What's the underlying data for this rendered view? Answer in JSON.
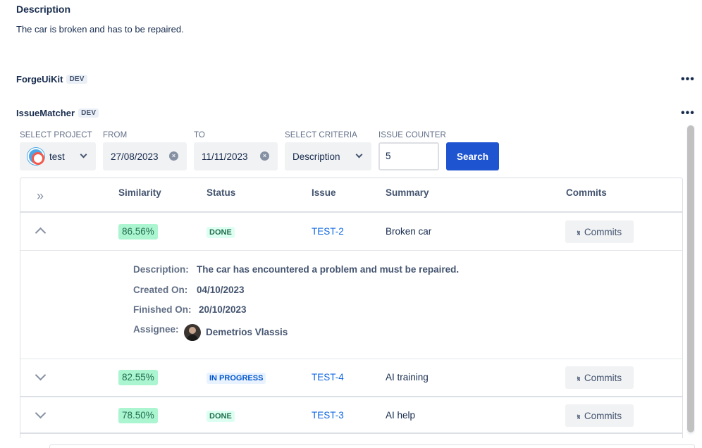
{
  "description": {
    "title": "Description",
    "text": "The car is broken and has to be repaired."
  },
  "apps": [
    {
      "name": "ForgeUiKit",
      "env": "DEV",
      "more": "•••"
    },
    {
      "name": "IssueMatcher",
      "env": "DEV",
      "more": "•••"
    }
  ],
  "filters": {
    "project": {
      "label": "SELECT PROJECT",
      "value": "test"
    },
    "from": {
      "label": "FROM",
      "value": "27/08/2023"
    },
    "to": {
      "label": "TO",
      "value": "11/11/2023"
    },
    "criteria": {
      "label": "SELECT CRITERIA",
      "value": "Description"
    },
    "counter": {
      "label": "ISSUE COUNTER",
      "value": "5"
    },
    "search_label": "Search"
  },
  "table": {
    "headers": [
      "Similarity",
      "Status",
      "Issue",
      "Summary",
      "Commits"
    ],
    "expand_all_icon": "»",
    "rows": [
      {
        "similarity": "86.56%",
        "status": "DONE",
        "issue": "TEST-2",
        "summary": "Broken car",
        "commits": "Commits"
      },
      {
        "similarity": "82.55%",
        "status": "IN PROGRESS",
        "issue": "TEST-4",
        "summary": "AI training",
        "commits": "Commits"
      },
      {
        "similarity": "78.50%",
        "status": "DONE",
        "issue": "TEST-3",
        "summary": "AI help",
        "commits": "Commits"
      }
    ],
    "details": {
      "description_label": "Description:",
      "description_value": "The car has encountered a problem and must be repaired.",
      "created_label": "Created On:",
      "created_value": "04/10/2023",
      "finished_label": "Finished On:",
      "finished_value": "20/10/2023",
      "assignee_label": "Assignee:",
      "assignee_value": "Demetrios Vlassis"
    }
  },
  "colors": {
    "primary": "#1F54D1",
    "done_bg": "#DCFFF1",
    "progress_bg": "#E9F2FF",
    "similarity_bg": "#ABF5D1"
  }
}
